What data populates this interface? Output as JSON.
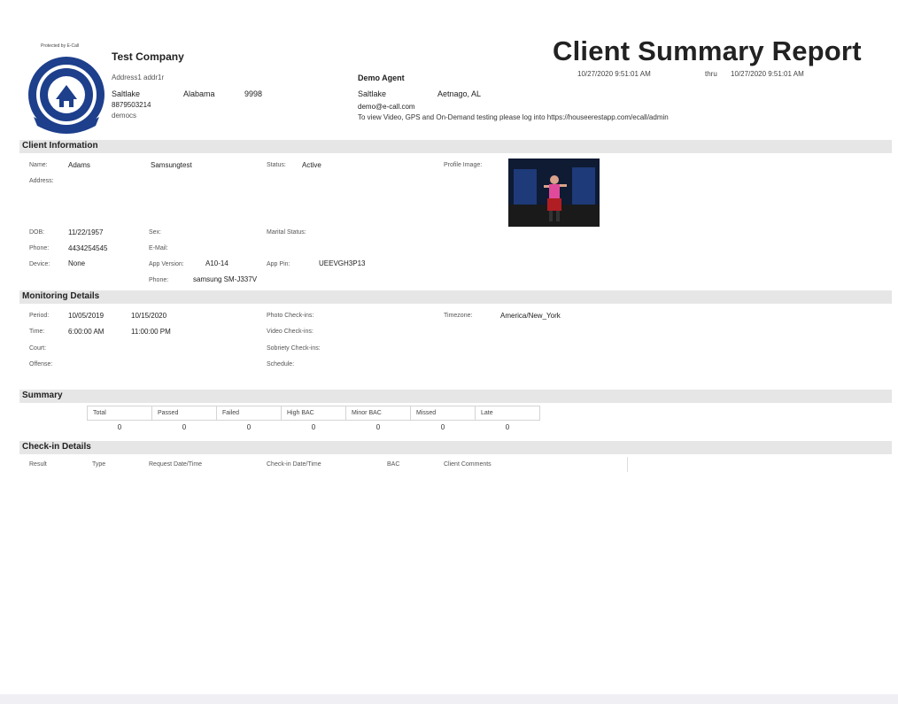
{
  "header": {
    "logo_caption": "Protected by E-Call",
    "company_name": "Test Company",
    "address": "Address1 addr1r",
    "city": "Saltlake",
    "state": "Alabama",
    "zip": "9998",
    "phone": "8879503214",
    "code": "democs",
    "agent_title": "Demo Agent",
    "agent_city": "Saltlake",
    "agent_location": "Aetnago, AL",
    "agent_email": "demo@e-call.com",
    "agent_notice": "To view Video, GPS and On-Demand testing please log into https://houseerestapp.com/ecall/admin",
    "report_title": "Client Summary Report",
    "report_date": "10/27/2020 9:51:01 AM",
    "report_thru_label": "thru",
    "report_thru_date": "10/27/2020 9:51:01 AM"
  },
  "client_info": {
    "section_title": "Client Information",
    "name_label": "Name:",
    "name_first": "Adams",
    "name_last": "Samsungtest",
    "status_label": "Status:",
    "status_value": "Active",
    "profile_label": "Profile Image:",
    "address_label": "Address:",
    "dob_label": "DOB:",
    "dob_value": "11/22/1957",
    "sex_label": "Sex:",
    "marital_label": "Marital Status:",
    "phone_label": "Phone:",
    "phone_value": "4434254545",
    "email_label": "E-Mail:",
    "device_label": "Device:",
    "device_value": "None",
    "app_version_label": "App Version:",
    "app_version_value": "A10-14",
    "app_pin_label": "App Pin:",
    "app_pin_value": "UEEVGH3P13",
    "phone2_label": "Phone:",
    "phone2_value": "samsung SM-J337V"
  },
  "monitoring": {
    "section_title": "Monitoring Details",
    "period_label": "Period:",
    "period_start": "10/05/2019",
    "period_end": "10/15/2020",
    "photo_label": "Photo Check-ins:",
    "timezone_label": "Timezone:",
    "timezone_value": "America/New_York",
    "time_label": "Time:",
    "time_start": "6:00:00 AM",
    "time_end": "11:00:00 PM",
    "video_label": "Video Check-ins:",
    "court_label": "Court:",
    "sobriety_label": "Sobriety Check-ins:",
    "offense_label": "Offense:",
    "schedule_label": "Schedule:"
  },
  "summary": {
    "section_title": "Summary",
    "headers": [
      "Total",
      "Passed",
      "Failed",
      "High BAC",
      "Minor BAC",
      "Missed",
      "Late"
    ],
    "values": [
      "0",
      "0",
      "0",
      "0",
      "0",
      "0",
      "0"
    ]
  },
  "checkin": {
    "section_title": "Check-in Details",
    "columns": [
      "Result",
      "Type",
      "Request Date/Time",
      "Check-in Date/Time",
      "BAC",
      "Client Comments"
    ]
  },
  "colors": {
    "section_bg": "#e6e6e6",
    "logo_blue": "#1d3f8c"
  }
}
